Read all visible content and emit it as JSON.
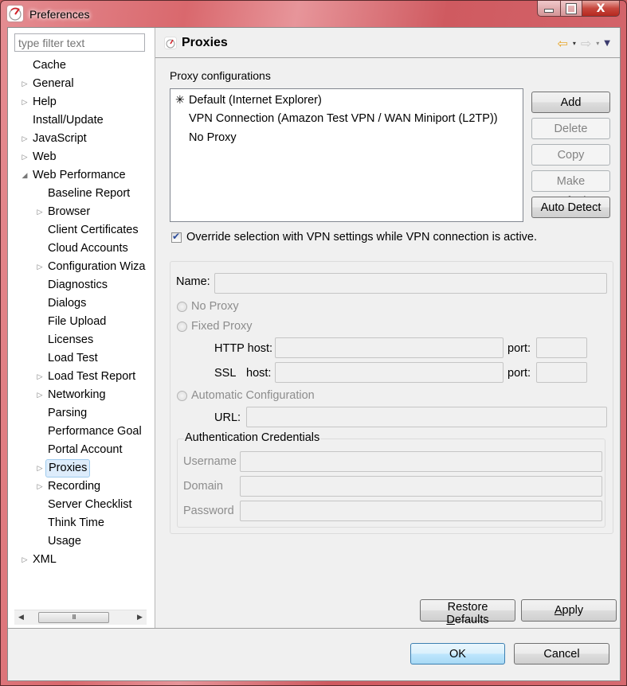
{
  "window": {
    "title": "Preferences",
    "controls": {
      "minimize": "—",
      "maximize": "▫",
      "close": "X"
    }
  },
  "filter": {
    "placeholder": "type filter text",
    "value": ""
  },
  "tree": [
    {
      "label": "Cache",
      "level": 0,
      "expander": "none"
    },
    {
      "label": "General",
      "level": 0,
      "expander": "collapsed"
    },
    {
      "label": "Help",
      "level": 0,
      "expander": "collapsed"
    },
    {
      "label": "Install/Update",
      "level": 0,
      "expander": "none"
    },
    {
      "label": "JavaScript",
      "level": 0,
      "expander": "collapsed"
    },
    {
      "label": "Web",
      "level": 0,
      "expander": "collapsed"
    },
    {
      "label": "Web Performance",
      "level": 0,
      "expander": "expanded"
    },
    {
      "label": "Baseline Report",
      "level": 1,
      "expander": "none"
    },
    {
      "label": "Browser",
      "level": 1,
      "expander": "collapsed"
    },
    {
      "label": "Client Certificates",
      "level": 1,
      "expander": "none"
    },
    {
      "label": "Cloud Accounts",
      "level": 1,
      "expander": "none"
    },
    {
      "label": "Configuration Wiza",
      "level": 1,
      "expander": "collapsed"
    },
    {
      "label": "Diagnostics",
      "level": 1,
      "expander": "none"
    },
    {
      "label": "Dialogs",
      "level": 1,
      "expander": "none"
    },
    {
      "label": "File Upload",
      "level": 1,
      "expander": "none"
    },
    {
      "label": "Licenses",
      "level": 1,
      "expander": "none"
    },
    {
      "label": "Load Test",
      "level": 1,
      "expander": "none"
    },
    {
      "label": "Load Test Report",
      "level": 1,
      "expander": "collapsed"
    },
    {
      "label": "Networking",
      "level": 1,
      "expander": "collapsed"
    },
    {
      "label": "Parsing",
      "level": 1,
      "expander": "none"
    },
    {
      "label": "Performance Goal",
      "level": 1,
      "expander": "none"
    },
    {
      "label": "Portal Account",
      "level": 1,
      "expander": "none"
    },
    {
      "label": "Proxies",
      "level": 1,
      "expander": "collapsed",
      "selected": true
    },
    {
      "label": "Recording",
      "level": 1,
      "expander": "collapsed"
    },
    {
      "label": "Server Checklist",
      "level": 1,
      "expander": "none"
    },
    {
      "label": "Think Time",
      "level": 1,
      "expander": "none"
    },
    {
      "label": "Usage",
      "level": 1,
      "expander": "none"
    },
    {
      "label": "XML",
      "level": 0,
      "expander": "collapsed"
    }
  ],
  "scrollbar": {
    "grip": "III"
  },
  "page": {
    "title": "Proxies",
    "nav": {
      "back": "⇦",
      "forward": "⇨",
      "dropdown": "▾",
      "menu": "▼"
    },
    "section_label": "Proxy configurations",
    "configurations": [
      {
        "label": "Default (Internet Explorer)",
        "default_marker": "✳"
      },
      {
        "label": "VPN Connection (Amazon Test VPN / WAN Miniport (L2TP))",
        "default_marker": ""
      },
      {
        "label": "No Proxy",
        "default_marker": ""
      }
    ],
    "buttons": {
      "add": "Add",
      "delete": "Delete",
      "copy": "Copy",
      "make_default": "Make Default",
      "auto_detect": "Auto Detect"
    },
    "override_checkbox": {
      "label": "Override selection with VPN settings while VPN connection is active.",
      "checked": true
    },
    "editor": {
      "name_label": "Name:",
      "name_value": "",
      "radio_no_proxy": "No Proxy",
      "radio_fixed_proxy": "Fixed Proxy",
      "http_label": "HTTP host:",
      "ssl_label": "SSL",
      "ssl_host_label": "host:",
      "port_label": "port:",
      "http_host": "",
      "http_port": "",
      "ssl_host": "",
      "ssl_port": "",
      "radio_auto": "Automatic Configuration",
      "url_label": "URL:",
      "url_value": "",
      "auth_title": "Authentication Credentials",
      "username_label": "Username",
      "domain_label": "Domain",
      "password_label": "Password",
      "username": "",
      "domain": "",
      "password": ""
    },
    "restore_defaults": {
      "pre": "Restore ",
      "mnemonic": "D",
      "post": "efaults"
    },
    "apply": {
      "pre": "",
      "mnemonic": "A",
      "post": "pply"
    }
  },
  "footer": {
    "ok": "OK",
    "cancel": "Cancel"
  }
}
